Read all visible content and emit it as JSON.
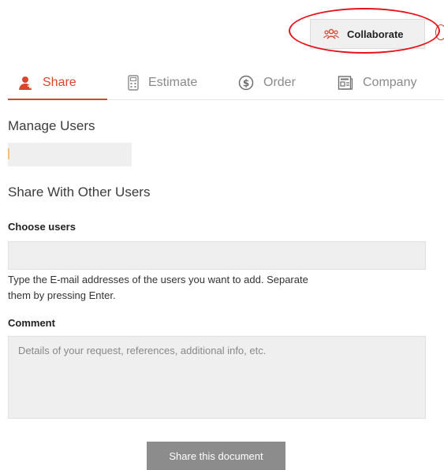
{
  "header": {
    "collaborate_label": "Collaborate",
    "collaborate_icon": "users-icon"
  },
  "tabs": [
    {
      "label": "Share",
      "icon": "share-user-icon",
      "active": true
    },
    {
      "label": "Estimate",
      "icon": "calculator-icon",
      "active": false
    },
    {
      "label": "Order",
      "icon": "dollar-circle-icon",
      "active": false
    },
    {
      "label": "Company",
      "icon": "company-card-icon",
      "active": false
    }
  ],
  "manage_users": {
    "title": "Manage Users"
  },
  "share_section": {
    "title": "Share With Other Users",
    "choose_users_label": "Choose users",
    "choose_users_value": "",
    "help_text": "Type the E-mail addresses of the users you want to add. Separate them by pressing Enter.",
    "comment_label": "Comment",
    "comment_placeholder": "Details of your request, references, additional info, etc.",
    "submit_label": "Share this document"
  },
  "colors": {
    "accent": "#d9472b",
    "annotation": "#e8121b",
    "button_bg": "#8c8c8c"
  }
}
